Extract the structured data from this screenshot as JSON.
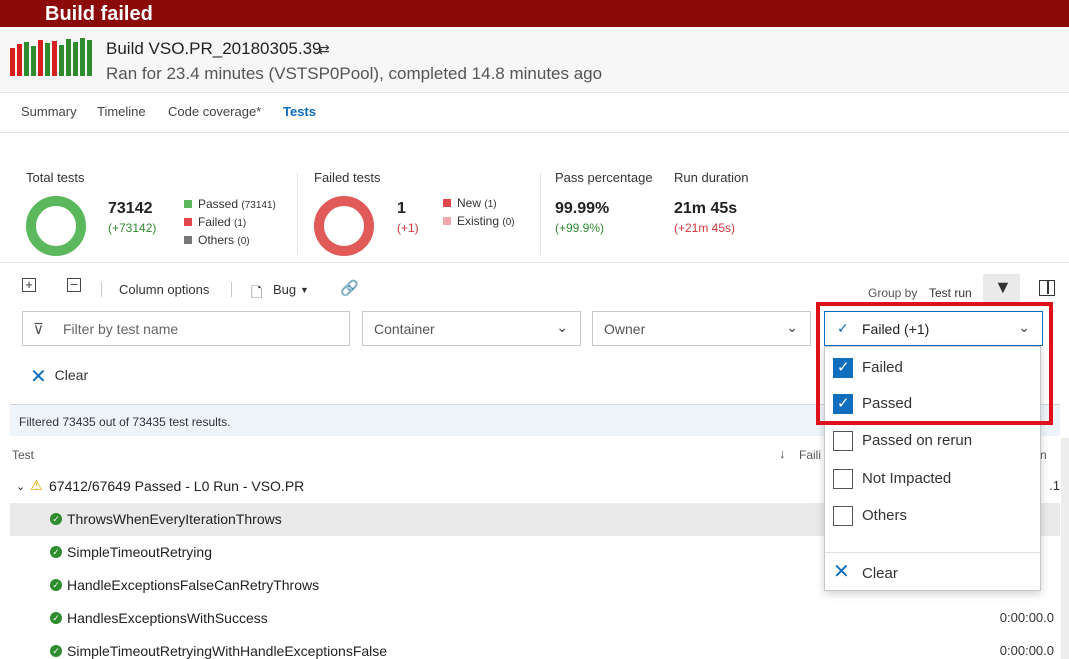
{
  "banner": {
    "title": "Build failed"
  },
  "header": {
    "build_title": "Build VSO.PR_20180305.39",
    "pr_icon": "git-pull-request-icon",
    "subtitle": "Ran for 23.4 minutes (VSTSP0Pool), completed 14.8 minutes ago"
  },
  "tabs": [
    {
      "label": "Summary"
    },
    {
      "label": "Timeline"
    },
    {
      "label": "Code coverage*"
    },
    {
      "label": "Tests"
    }
  ],
  "summary": {
    "total": {
      "label": "Total tests",
      "value": "73142",
      "delta": "(+73142)",
      "legend": [
        {
          "label": "Passed",
          "count": "(73141)",
          "color": "#5cb85c"
        },
        {
          "label": "Failed",
          "count": "(1)",
          "color": "#e0474c"
        },
        {
          "label": "Others",
          "count": "(0)",
          "color": "#777777"
        }
      ]
    },
    "failed": {
      "label": "Failed tests",
      "value": "1",
      "delta": "(+1)",
      "legend": [
        {
          "label": "New",
          "count": "(1)",
          "color": "#e0474c"
        },
        {
          "label": "Existing",
          "count": "(0)",
          "color": "#f0a7aa"
        }
      ]
    },
    "pass_pct": {
      "label": "Pass percentage",
      "value": "99.99%",
      "delta": "(+99.9%)"
    },
    "duration": {
      "label": "Run duration",
      "value": "21m 45s",
      "delta": "(+21m 45s)"
    }
  },
  "toolbar": {
    "column_options": "Column options",
    "bug": "Bug",
    "group_by_label": "Group by",
    "group_by_value": "Test run"
  },
  "filters": {
    "search_placeholder": "Filter by test name",
    "container": "Container",
    "owner": "Owner",
    "outcome": "Failed (+1)",
    "clear": "Clear"
  },
  "outcome_dropdown": {
    "items": [
      {
        "label": "Failed",
        "checked": true
      },
      {
        "label": "Passed",
        "checked": true
      },
      {
        "label": "Passed on rerun",
        "checked": false
      },
      {
        "label": "Not Impacted",
        "checked": false
      },
      {
        "label": "Others",
        "checked": false
      }
    ],
    "clear": "Clear"
  },
  "results": {
    "filtered_text": "Filtered 73435 out of 73435 test results.",
    "col_test": "Test",
    "col_failing": "Faili",
    "col_duration": "n",
    "group_label": "67412/67649 Passed - L0 Run - VSO.PR",
    "rows": [
      {
        "name": "ThrowsWhenEveryIterationThrows",
        "duration": ""
      },
      {
        "name": "SimpleTimeoutRetrying",
        "duration": ""
      },
      {
        "name": "HandleExceptionsFalseCanRetryThrows",
        "duration": ""
      },
      {
        "name": "HandlesExceptionsWithSuccess",
        "duration": "0:00:00.0"
      },
      {
        "name": "SimpleTimeoutRetryingWithHandleExceptionsFalse",
        "duration": "0:00:00.0"
      }
    ]
  }
}
